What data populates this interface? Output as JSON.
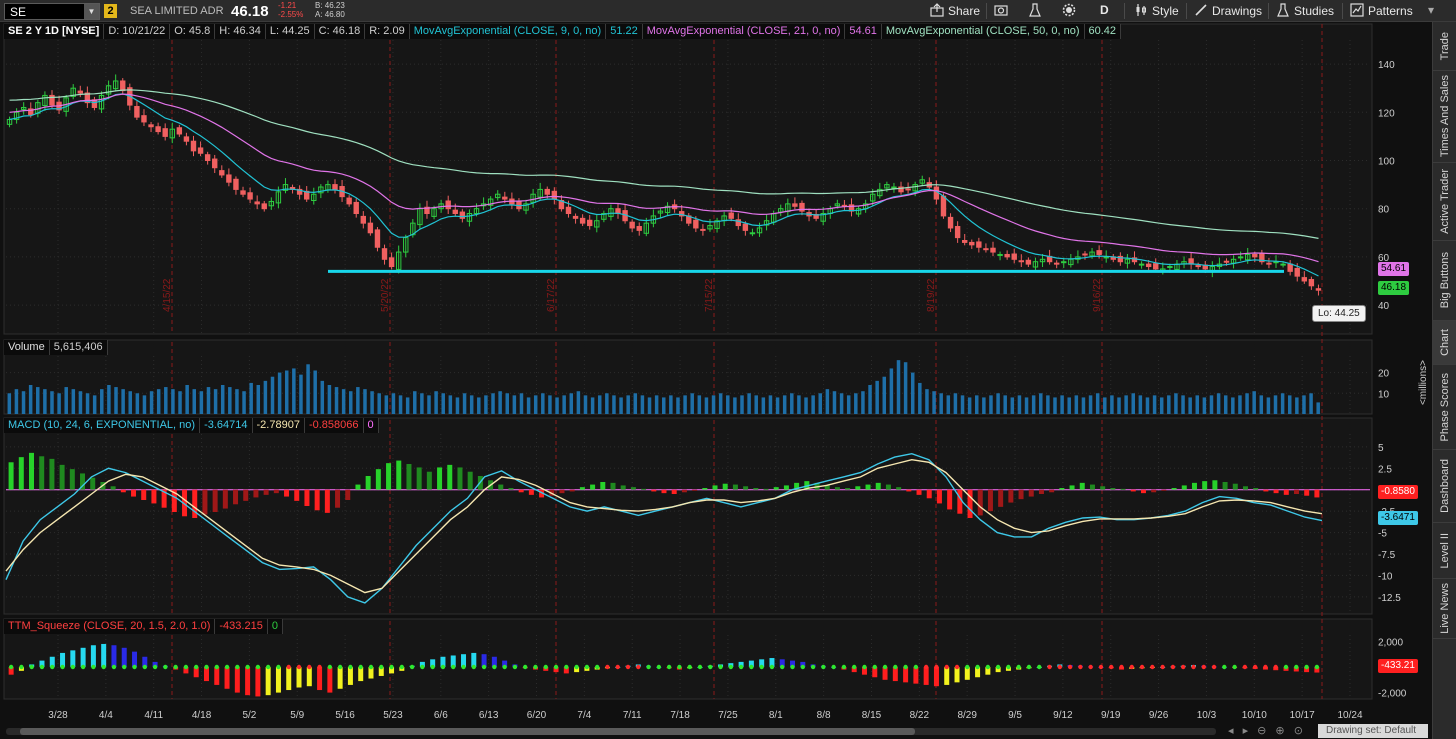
{
  "toolbar": {
    "symbol": "SE",
    "link_badge": "2",
    "company": "SEA LIMITED ADR",
    "last": "46.18",
    "change": "-1.21",
    "change_pct": "-2.55%",
    "bid": "B: 46.23",
    "ask": "A: 46.80",
    "share": "Share",
    "timeframe": "D",
    "style": "Style",
    "drawings": "Drawings",
    "studies": "Studies",
    "patterns": "Patterns"
  },
  "price_header": {
    "title": "SE 2 Y 1D [NYSE]",
    "d": "D: 10/21/22",
    "o": "O: 45.8",
    "h": "H: 46.34",
    "l": "L: 44.25",
    "c": "C: 46.18",
    "r": "R: 2.09",
    "ema9_label": "MovAvgExponential (CLOSE, 9, 0, no)",
    "ema9_value": "51.22",
    "ema21_label": "MovAvgExponential (CLOSE, 21, 0, no)",
    "ema21_value": "54.61",
    "ema50_label": "MovAvgExponential (CLOSE, 50, 0, no)",
    "ema50_value": "60.42"
  },
  "price_tags": {
    "ema21": "54.61",
    "last": "46.18",
    "lo": "Lo: 44.25"
  },
  "volume_header": {
    "label": "Volume",
    "value": "5,615,406"
  },
  "volume_unit": "<millions>",
  "macd_header": {
    "label": "MACD (10, 24, 6, EXPONENTIAL, no)",
    "value": "-3.64714",
    "avg": "-2.78907",
    "diff": "-0.858066",
    "zero": "0"
  },
  "macd_tags": {
    "diff": "-0.8580",
    "value": "-3.6471"
  },
  "squeeze_header": {
    "label": "TTM_Squeeze (CLOSE, 20, 1.5, 2.0, 1.0)",
    "value": "-433.215",
    "zero": "0"
  },
  "squeeze_tag": "-433.21",
  "drawing_set": "Drawing set: Default",
  "sidebar": [
    "Trade",
    "Times And Sales",
    "Active Trader",
    "Big Buttons",
    "Chart",
    "Phase Scores",
    "Dashboard",
    "Level II",
    "Live News"
  ],
  "colors": {
    "background": "#101010",
    "up": "#2ecc40",
    "down": "#f06060",
    "ema9": "#21c3d4",
    "ema21": "#e074e8",
    "ema50": "#9fe0c0",
    "support_line": "#18d6ea",
    "volume": "#1e6fa8",
    "macd_value": "#3ec8e8",
    "macd_avg": "#f5e6b0",
    "macd_zero": "#ff6fff",
    "vertical_marker": "#8b1a1a"
  },
  "chart_data": {
    "type": "candlestick",
    "date_markers": [
      "4/15/22",
      "5/20/22",
      "6/17/22",
      "7/15/22",
      "8/19/22",
      "9/16/22"
    ],
    "x_ticks": [
      "3/28",
      "4/4",
      "4/11",
      "4/18",
      "5/2",
      "5/9",
      "5/16",
      "5/23",
      "6/6",
      "6/13",
      "6/20",
      "7/4",
      "7/11",
      "7/18",
      "7/25",
      "8/1",
      "8/8",
      "8/15",
      "8/22",
      "8/29",
      "9/5",
      "9/12",
      "9/19",
      "9/26",
      "10/3",
      "10/10",
      "10/17",
      "10/24"
    ],
    "price_axis": {
      "ticks": [
        40,
        60,
        80,
        100,
        120,
        140
      ],
      "range": [
        28,
        150
      ]
    },
    "volume_axis": {
      "ticks": [
        10,
        20
      ],
      "range": [
        0,
        28
      ],
      "unit": "millions"
    },
    "macd_axis": {
      "ticks": [
        5,
        2.5,
        0,
        -2.5,
        -5,
        -7.5,
        -10,
        -12.5
      ],
      "range": [
        -14.5,
        6.5
      ]
    },
    "squeeze_axis": {
      "ticks": [
        "2,000",
        "0",
        "-2,000"
      ],
      "values": [
        2000,
        0,
        -2000
      ],
      "range": [
        -2500,
        2500
      ]
    },
    "support_level": 54,
    "closes": [
      117,
      120,
      122,
      119,
      124,
      127,
      123,
      121,
      126,
      130,
      128,
      124,
      122,
      127,
      131,
      133,
      129,
      123,
      118,
      116,
      114,
      112,
      110,
      113,
      111,
      108,
      104,
      103,
      100,
      97,
      94,
      91,
      88,
      86,
      84,
      82,
      80,
      83,
      87,
      90,
      88,
      86,
      84,
      86,
      89,
      90,
      88,
      85,
      82,
      78,
      74,
      70,
      64,
      59,
      56,
      62,
      68,
      74,
      80,
      78,
      80,
      82,
      80,
      78,
      76,
      78,
      80,
      82,
      84,
      86,
      84,
      82,
      80,
      82,
      86,
      88,
      86,
      84,
      80,
      78,
      76,
      74,
      73,
      75,
      78,
      80,
      78,
      75,
      72,
      71,
      74,
      77,
      79,
      81,
      80,
      77,
      74,
      72,
      71,
      73,
      75,
      77,
      76,
      73,
      71,
      70,
      72,
      75,
      78,
      80,
      82,
      81,
      79,
      77,
      76,
      78,
      80,
      82,
      81,
      79,
      80,
      82,
      86,
      88,
      90,
      89,
      87,
      88,
      90,
      92,
      89,
      84,
      77,
      72,
      68,
      66,
      65,
      64,
      63,
      62,
      61,
      60,
      59,
      58,
      57,
      58,
      59,
      58,
      57,
      58,
      59,
      60,
      61,
      62,
      61,
      60,
      59,
      58,
      59,
      58,
      57,
      56,
      55,
      55,
      56,
      57,
      58,
      57,
      56,
      55,
      56,
      57,
      58,
      59,
      60,
      61,
      60,
      58,
      57,
      58,
      57,
      54,
      52,
      50,
      48,
      46.18
    ],
    "volume": [
      10,
      12,
      11,
      14,
      13,
      12,
      11,
      10,
      13,
      12,
      11,
      10,
      9,
      12,
      14,
      13,
      12,
      11,
      10,
      9,
      11,
      12,
      13,
      12,
      11,
      14,
      12,
      11,
      13,
      12,
      14,
      13,
      12,
      11,
      15,
      14,
      16,
      18,
      20,
      21,
      22,
      19,
      24,
      21,
      16,
      14,
      13,
      12,
      11,
      13,
      12,
      11,
      10,
      9,
      10,
      9,
      8,
      11,
      10,
      9,
      11,
      10,
      9,
      8,
      10,
      9,
      8,
      9,
      10,
      11,
      10,
      9,
      10,
      8,
      9,
      10,
      9,
      8,
      9,
      10,
      11,
      9,
      8,
      9,
      10,
      9,
      8,
      9,
      10,
      9,
      8,
      9,
      8,
      9,
      8,
      9,
      10,
      9,
      8,
      9,
      10,
      9,
      8,
      9,
      10,
      9,
      8,
      9,
      8,
      9,
      10,
      9,
      8,
      9,
      10,
      12,
      11,
      10,
      9,
      10,
      11,
      14,
      16,
      18,
      22,
      26,
      25,
      20,
      15,
      12,
      11,
      10,
      9,
      10,
      9,
      8,
      9,
      8,
      9,
      10,
      9,
      8,
      9,
      8,
      9,
      10,
      9,
      8,
      9,
      8,
      9,
      8,
      9,
      10,
      8,
      9,
      8,
      9,
      10,
      9,
      8,
      9,
      8,
      9,
      10,
      9,
      8,
      9,
      8,
      9,
      10,
      9,
      8,
      9,
      10,
      11,
      9,
      8,
      9,
      10,
      9,
      8,
      9,
      10,
      5.6
    ],
    "macd_hist": [
      3.2,
      3.8,
      4.3,
      3.9,
      3.6,
      2.9,
      2.4,
      1.9,
      1.4,
      0.9,
      0.4,
      -0.3,
      -0.8,
      -1.2,
      -1.6,
      -2.1,
      -2.6,
      -3.1,
      -3.3,
      -2.9,
      -2.6,
      -2.2,
      -1.7,
      -1.3,
      -0.9,
      -0.6,
      -0.4,
      -0.8,
      -1.3,
      -1.9,
      -2.4,
      -2.7,
      -2.1,
      -1.2,
      0.6,
      1.6,
      2.4,
      3.1,
      3.4,
      3.0,
      2.6,
      2.1,
      2.6,
      2.9,
      2.6,
      2.1,
      1.6,
      1.1,
      0.6,
      0.2,
      -0.3,
      -0.6,
      -0.9,
      -0.7,
      -0.4,
      -0.2,
      0.3,
      0.6,
      0.9,
      0.8,
      0.5,
      0.3,
      0.1,
      -0.2,
      -0.4,
      -0.5,
      -0.3,
      -0.1,
      0.2,
      0.5,
      0.7,
      0.6,
      0.4,
      0.2,
      0.1,
      0.3,
      0.5,
      0.8,
      1.0,
      0.8,
      0.5,
      0.3,
      0.2,
      0.4,
      0.6,
      0.8,
      0.6,
      0.3,
      -0.2,
      -0.6,
      -1.0,
      -1.6,
      -2.3,
      -2.8,
      -3.3,
      -3.0,
      -2.5,
      -2.0,
      -1.5,
      -1.1,
      -0.8,
      -0.5,
      -0.3,
      0.2,
      0.5,
      0.8,
      0.6,
      0.4,
      0.2,
      0.1,
      -0.2,
      -0.4,
      -0.3,
      -0.1,
      0.2,
      0.5,
      0.8,
      1.0,
      1.1,
      0.9,
      0.7,
      0.4,
      0.2,
      -0.2,
      -0.4,
      -0.6,
      -0.5,
      -0.7,
      -0.9
    ],
    "macd_value": [
      -10.5,
      -6,
      -3.5,
      -2,
      -0.5,
      1.5,
      2.5,
      2,
      1,
      0,
      -1,
      -2.5,
      -4,
      -5.5,
      -7,
      -8.5,
      -9.3,
      -9.2,
      -9,
      -10.5,
      -12.5,
      -13.2,
      -11.5,
      -9,
      -6.5,
      -4.5,
      -2.5,
      -1,
      1.5,
      2.2,
      1,
      0,
      -1,
      -2,
      -2.5,
      -2,
      -2.5,
      -3,
      -2.5,
      -2,
      -1.5,
      -1,
      -1.5,
      -2,
      -1.5,
      -1,
      0,
      0.5,
      1,
      1.5,
      2,
      3,
      3.8,
      4.2,
      3.5,
      1.5,
      -1.5,
      -3.5,
      -5,
      -5.5,
      -5.5,
      -4.5,
      -3.8,
      -3.3,
      -3.2,
      -3.5,
      -3.5,
      -3.3,
      -3,
      -2.5,
      -1.5,
      -0.8,
      -1,
      -1.5,
      -1.8,
      -2.5,
      -3.2,
      -3.6
    ],
    "macd_avg": [
      -9.5,
      -7,
      -5,
      -3.5,
      -2,
      -0.5,
      1,
      1.8,
      1.5,
      0.5,
      -0.5,
      -2,
      -3.5,
      -5,
      -6.5,
      -8,
      -8.8,
      -9,
      -9.3,
      -10,
      -11,
      -12,
      -11.5,
      -9.5,
      -7.5,
      -5.5,
      -3.5,
      -2,
      0,
      1.5,
      1.2,
      0.5,
      -0.5,
      -1.5,
      -2,
      -2.2,
      -2.4,
      -2.5,
      -2.3,
      -2,
      -1.5,
      -1.2,
      -1.2,
      -1.5,
      -1.3,
      -1,
      -0.3,
      0.2,
      0.5,
      1,
      1.5,
      2.5,
      3,
      3.5,
      3.2,
      2,
      0,
      -2,
      -3.5,
      -4.5,
      -5,
      -4.8,
      -4.2,
      -3.7,
      -3.4,
      -3.4,
      -3.4,
      -3.3,
      -3.1,
      -2.8,
      -2,
      -1.3,
      -1.2,
      -1.3,
      -1.5,
      -2,
      -2.5,
      -2.8
    ],
    "squeeze_hist": [
      -600,
      -300,
      200,
      500,
      800,
      1100,
      1300,
      1500,
      1700,
      1800,
      1700,
      1500,
      1200,
      800,
      400,
      100,
      -200,
      -500,
      -800,
      -1100,
      -1400,
      -1700,
      -2000,
      -2200,
      -2300,
      -2200,
      -2000,
      -1800,
      -1600,
      -1500,
      -1800,
      -2000,
      -1700,
      -1400,
      -1100,
      -900,
      -700,
      -500,
      -300,
      100,
      400,
      600,
      800,
      900,
      1000,
      1100,
      1000,
      800,
      500,
      200,
      -100,
      -200,
      -300,
      -400,
      -500,
      -400,
      -300,
      -200,
      -100,
      0,
      100,
      200,
      100,
      0,
      -100,
      -200,
      -100,
      0,
      100,
      200,
      300,
      400,
      500,
      600,
      700,
      600,
      500,
      400,
      200,
      100,
      0,
      -200,
      -400,
      -600,
      -800,
      -1000,
      -1100,
      -1200,
      -1300,
      -1400,
      -1500,
      -1400,
      -1200,
      -1000,
      -800,
      -600,
      -400,
      -300,
      -200,
      -100,
      0,
      100,
      200,
      150,
      100,
      50,
      0,
      -100,
      -200,
      -150,
      -100,
      -50,
      0,
      50,
      100,
      150,
      100,
      50,
      0,
      -50,
      -100,
      -150,
      -200,
      -250,
      -300,
      -350,
      -400,
      -433
    ]
  }
}
